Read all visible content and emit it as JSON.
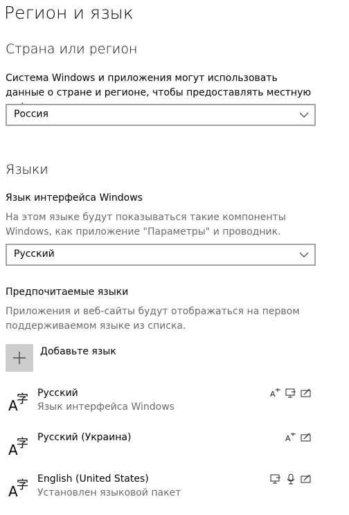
{
  "page": {
    "title": "Регион и язык"
  },
  "region": {
    "title": "Страна или регион",
    "description": "Система Windows и приложения могут использовать данные о стране и регионе, чтобы предоставлять местную информацию",
    "selected": "Россия"
  },
  "languages": {
    "title": "Языки",
    "display_label": "Язык интерфейса Windows",
    "display_description": "На этом языке будут показываться такие компоненты Windows, как приложение \"Параметры\" и проводник.",
    "display_selected": "Русский",
    "preferred_label": "Предпочитаемые языки",
    "preferred_description": "Приложения и веб-сайты будут отображаться на первом поддерживаемом языке из списка.",
    "add_label": "Добавьте язык",
    "items": [
      {
        "name": "Русский",
        "sub": "Язык интерфейса Windows",
        "features": [
          "text-to-speech-icon",
          "display-language-icon",
          "handwriting-icon"
        ]
      },
      {
        "name": "Русский (Украина)",
        "sub": "",
        "features": [
          "text-to-speech-icon",
          "handwriting-icon"
        ]
      },
      {
        "name": "English (United States)",
        "sub": "Установлен языковой пакет",
        "features": [
          "display-language-icon",
          "speech-recognition-icon",
          "handwriting-icon"
        ]
      }
    ]
  },
  "icons": {
    "language_glyph_a": "A",
    "language_glyph_z": "字"
  }
}
